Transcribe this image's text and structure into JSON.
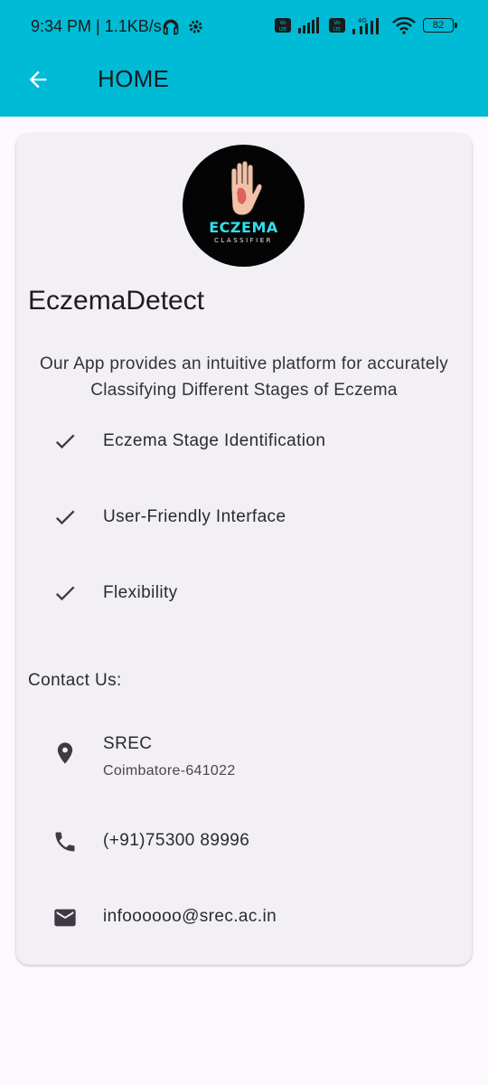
{
  "status_bar": {
    "time": "9:34 PM | 1.1KB/s",
    "battery": "82",
    "network_label": "4G",
    "volte_label": "Vo LTE"
  },
  "app_bar": {
    "title": "HOME"
  },
  "logo": {
    "line1": "ECZEMA",
    "line2": "CLASSIFIER"
  },
  "app_name": "EczemaDetect",
  "description": "Our App provides an intuitive platform for accurately Classifying Different Stages of Eczema",
  "features": [
    {
      "label": "Eczema Stage Identification"
    },
    {
      "label": "User-Friendly Interface"
    },
    {
      "label": "Flexibility"
    }
  ],
  "contact": {
    "heading": "Contact Us:",
    "location_name": "SREC",
    "location_detail": "Coimbatore-641022",
    "phone": "(+91)75300 89996",
    "email": "infoooooo@srec.ac.in"
  },
  "colors": {
    "appbar": "#00bbd6",
    "background": "#fdf8fd",
    "card": "#f2eff5",
    "logo_accent": "#2ee0ec"
  },
  "icons": [
    "back-arrow-icon",
    "headphones-icon",
    "settings-icon",
    "signal-icon",
    "wifi-icon",
    "battery-icon",
    "check-icon",
    "location-pin-icon",
    "phone-icon",
    "email-icon"
  ]
}
